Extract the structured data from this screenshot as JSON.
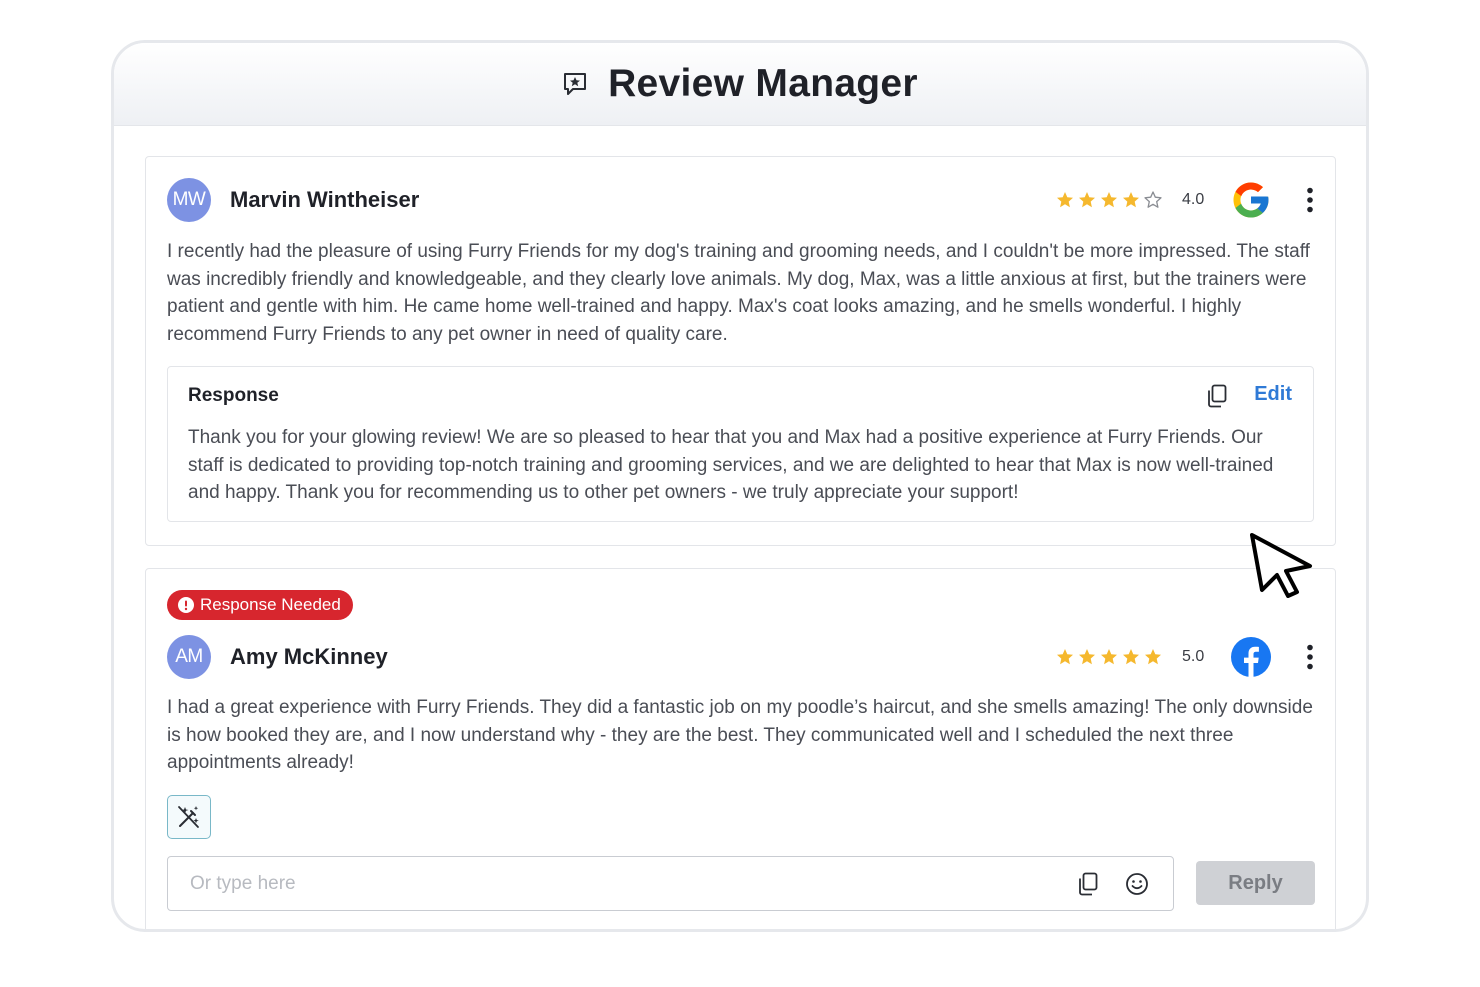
{
  "header": {
    "title": "Review Manager",
    "icon": "chat-star-icon"
  },
  "reviews": [
    {
      "initials": "MW",
      "name": "Marvin Wintheiser",
      "stars": 4,
      "rating": "4.0",
      "source": "google",
      "text": "I recently had the pleasure of using Furry Friends for my dog's training and grooming needs, and I couldn't be more impressed. The staff was incredibly friendly and knowledgeable, and they clearly love animals. My dog, Max, was a little anxious at first, but the trainers were patient and gentle with him. He came home well-trained and happy.  Max's coat looks amazing, and he smells wonderful. I highly recommend Furry Friends to any pet owner in need of quality care.",
      "response": {
        "title": "Response",
        "edit_label": "Edit",
        "text": "Thank you for your glowing review! We are so pleased to hear that you and Max had a positive experience at Furry Friends. Our staff is dedicated to providing top-notch training and grooming services, and we are delighted to hear that Max is now well-trained and happy. Thank you for recommending us to other pet owners - we truly appreciate your support!"
      }
    },
    {
      "badge": "Response Needed",
      "initials": "AM",
      "name": "Amy McKinney",
      "stars": 5,
      "rating": "5.0",
      "source": "facebook",
      "text": "I had a great experience with Furry Friends. They did a fantastic job on my poodle’s haircut, and she smells amazing! The only downside is how booked they are, and I now understand why - they are the best. They communicated well and I scheduled the next three appointments already!",
      "reply": {
        "placeholder": "Or type here",
        "button_label": "Reply"
      }
    }
  ],
  "colors": {
    "star": "#f5b82e",
    "avatar": "#7d92e3",
    "badge": "#d7262e",
    "link": "#2f7ad6",
    "facebook": "#1877f2"
  }
}
